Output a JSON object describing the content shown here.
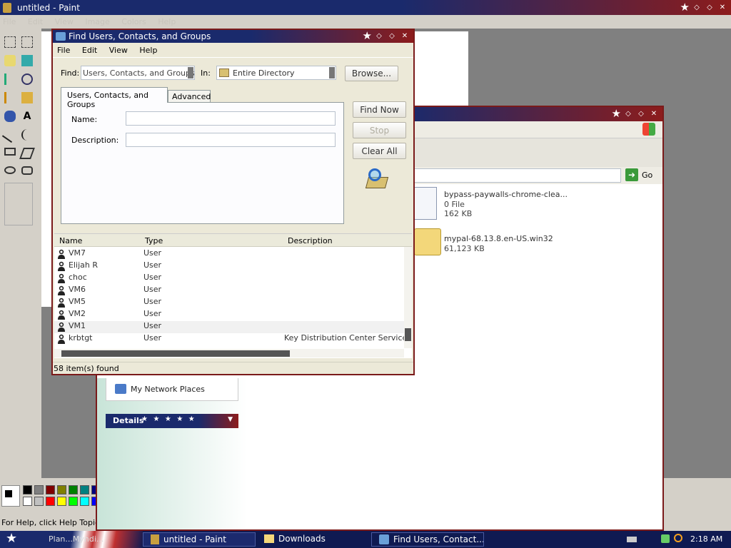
{
  "paint": {
    "title": "untitled - Paint",
    "menu": [
      "File",
      "Edit",
      "View",
      "Image",
      "Colors",
      "Help"
    ],
    "status": "For Help, click Help Topics on"
  },
  "explorer": {
    "go_label": "Go",
    "files": [
      {
        "name": "bypass-paywalls-chrome-clea...",
        "type": "0 File",
        "size": "162 KB"
      },
      {
        "name": "mypal-68.13.8.en-US.win32",
        "size": "61,123 KB"
      }
    ],
    "places_item": "My Network Places",
    "details_label": "Details"
  },
  "dialog": {
    "title": "Find Users, Contacts, and Groups",
    "menu": [
      "File",
      "Edit",
      "View",
      "Help"
    ],
    "find_label": "Find:",
    "find_value": "Users, Contacts, and Groups",
    "in_label": "In:",
    "in_value": "Entire Directory",
    "browse_label": "Browse...",
    "tabs": [
      "Users, Contacts, and Groups",
      "Advanced"
    ],
    "name_label": "Name:",
    "description_label": "Description:",
    "find_now_label": "Find Now",
    "stop_label": "Stop",
    "clear_all_label": "Clear All",
    "columns": [
      "Name",
      "Type",
      "Description"
    ],
    "results": [
      {
        "name": "VM7",
        "type": "User",
        "description": ""
      },
      {
        "name": "Elijah R",
        "type": "User",
        "description": ""
      },
      {
        "name": "choc",
        "type": "User",
        "description": ""
      },
      {
        "name": "VM6",
        "type": "User",
        "description": ""
      },
      {
        "name": "VM5",
        "type": "User",
        "description": ""
      },
      {
        "name": "VM2",
        "type": "User",
        "description": ""
      },
      {
        "name": "VM1",
        "type": "User",
        "description": ""
      },
      {
        "name": "krbtgt",
        "type": "User",
        "description": "Key Distribution Center Service Ac"
      }
    ],
    "status": "58 item(s) found"
  },
  "taskbar": {
    "tasks": [
      "Plan...Myndi...",
      "untitled - Paint",
      "Downloads",
      "Find Users, Contact..."
    ],
    "clock": "2:18 AM"
  },
  "colors": {
    "palette": [
      "#000000",
      "#808080",
      "#800000",
      "#808000",
      "#008000",
      "#008080",
      "#000080",
      "#ffffff",
      "#c0c0c0",
      "#ff0000",
      "#ffff00",
      "#00ff00",
      "#00ffff",
      "#0000ff"
    ]
  }
}
